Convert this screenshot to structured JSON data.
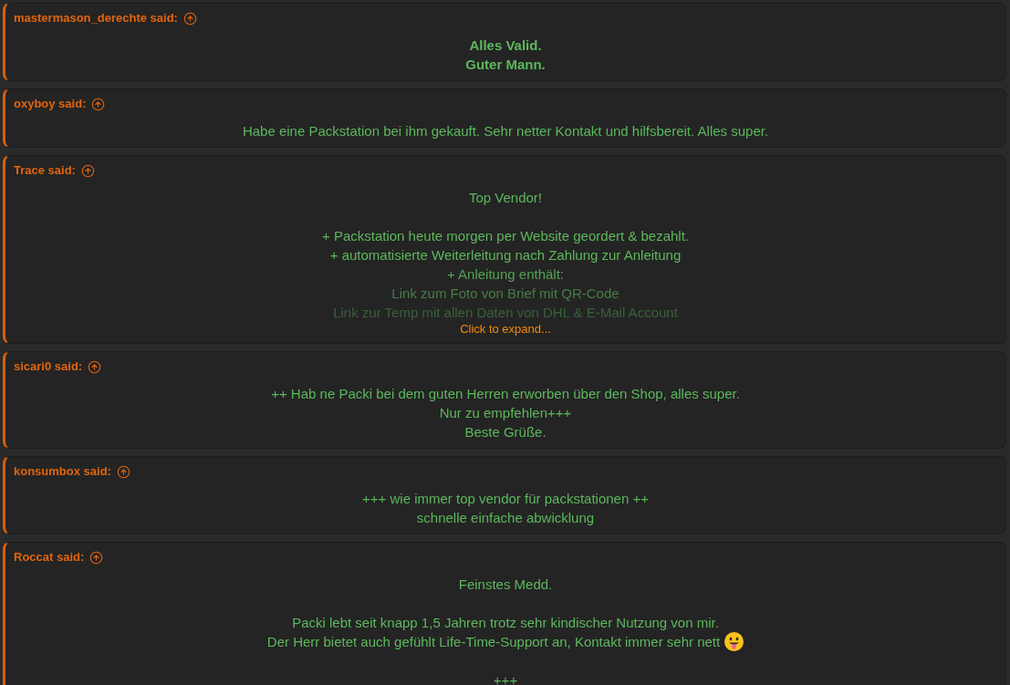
{
  "posts": [
    {
      "attribution": "mastermason_derechte said:",
      "bold": true,
      "collapsed": false,
      "paragraphs": [
        [
          "Alles Valid.",
          "Guter Mann."
        ]
      ]
    },
    {
      "attribution": "oxyboy said:",
      "bold": false,
      "collapsed": false,
      "paragraphs": [
        [
          "Habe eine Packstation bei ihm gekauft. Sehr netter Kontakt und hilfsbereit. Alles super."
        ]
      ]
    },
    {
      "attribution": "Trace said:",
      "bold": false,
      "collapsed": true,
      "expand_label": "Click to expand...",
      "paragraphs": [
        [
          "Top Vendor!"
        ],
        [
          "+ Packstation heute morgen per Website geordert & bezahlt.",
          "+ automatisierte Weiterleitung nach Zahlung zur Anleitung",
          "+ Anleitung enthält:",
          "Link zum Foto von Brief mit QR-Code",
          "Link zur Temp mit allen Daten von DHL & E-Mail Account"
        ]
      ]
    },
    {
      "attribution": "sicari0 said:",
      "bold": false,
      "collapsed": false,
      "paragraphs": [
        [
          "++ Hab ne Packi bei dem guten Herren erworben über den Shop, alles super.",
          "Nur zu empfehlen+++",
          "Beste Grüße."
        ]
      ]
    },
    {
      "attribution": "konsumbox said:",
      "bold": false,
      "collapsed": false,
      "paragraphs": [
        [
          "+++ wie immer top vendor für packstationen ++",
          "schnelle einfache abwicklung"
        ]
      ]
    },
    {
      "attribution": "Roccat said:",
      "bold": false,
      "collapsed": false,
      "paragraphs": [
        [
          "Feinstes Medd."
        ],
        [
          "Packi lebt seit knapp 1,5 Jahren trotz sehr kindischer Nutzung von mir.",
          {
            "text": "Der Herr bietet auch gefühlt Life-Time-Support an, Kontakt immer sehr nett",
            "emoji": true
          }
        ],
        [
          "+++"
        ]
      ]
    }
  ]
}
